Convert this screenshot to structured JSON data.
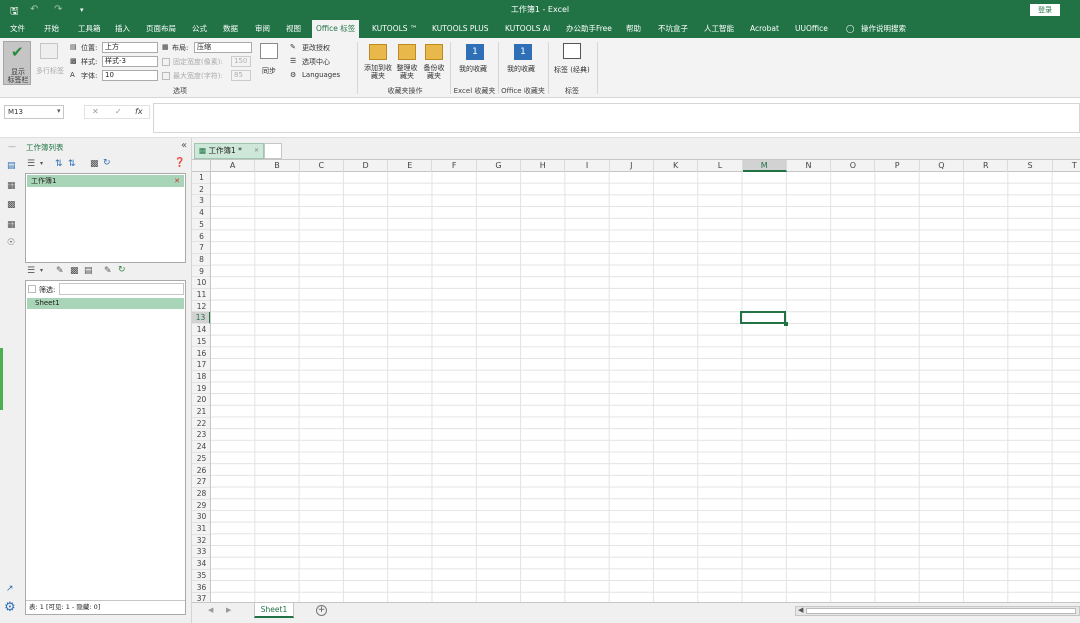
{
  "titlebar": {
    "title": "工作簿1  -  Excel",
    "login_label": "登录",
    "save_icon": "save-icon",
    "undo_icon": "undo-icon",
    "redo_icon": "redo-icon",
    "customize_icon": "customize-qa-icon"
  },
  "menu": {
    "tabs": [
      "文件",
      "开始",
      "工具箱",
      "插入",
      "页面布局",
      "公式",
      "数据",
      "审阅",
      "视图",
      "Office 标签",
      "KUTOOLS ™",
      "KUTOOLS PLUS",
      "KUTOOLS AI",
      "办公助手Free",
      "帮助",
      "不坑盒子",
      "人工智能",
      "Acrobat",
      "UUOffice"
    ],
    "active": "Office 标签",
    "search_label": "操作说明搜索"
  },
  "ribbon": {
    "show_tabbar": "显示\n标签栏",
    "multirow_tab": "多行标签",
    "position_label": "位置:",
    "position_value": "上方",
    "style_label": "样式:",
    "style_value": "样式-3",
    "font_label": "字体:",
    "font_value": "10",
    "layout_label": "布局:",
    "layout_value": "压缩",
    "fixed_width_label": "固定宽度(像素):",
    "fixed_width_value": "150",
    "max_width_label": "最大宽度(字符):",
    "max_width_value": "85",
    "sync_label": "同步",
    "change_auth": "更改授权",
    "options_center": "选项中心",
    "languages": "Languages",
    "group_options": "选项",
    "add_fav": "添加到收\n藏夹",
    "organize_fav": "整理收\n藏夹",
    "backup_fav": "备份收\n藏夹",
    "group_fav_ops": "收藏夹操作",
    "my_fav_excel": "我的收藏",
    "group_excel_fav": "Excel 收藏夹",
    "my_fav_office": "我的收藏",
    "group_office_fav": "Office 收藏夹",
    "tab_classic": "标签 (经典)",
    "group_tabs": "标签"
  },
  "formula_bar": {
    "name_box": "M13",
    "cancel": "✕",
    "enter": "✓",
    "fx": "fx"
  },
  "left_pane": {
    "title": "工作簿列表",
    "workbook_item": "工作簿1",
    "filter_label": "筛选:",
    "sheet_item": "Sheet1",
    "status": "表: 1  [可见: 1 - 隐藏: 0]"
  },
  "sheet_area": {
    "doc_tab": "工作簿1 *",
    "columns": [
      "A",
      "B",
      "C",
      "D",
      "E",
      "F",
      "G",
      "H",
      "I",
      "J",
      "K",
      "L",
      "M",
      "N",
      "O",
      "P",
      "Q",
      "R",
      "S",
      "T"
    ],
    "selected_column": "M",
    "rows": [
      "1",
      "2",
      "3",
      "4",
      "5",
      "6",
      "7",
      "8",
      "9",
      "10",
      "11",
      "12",
      "13",
      "14",
      "15",
      "16",
      "17",
      "18",
      "19",
      "20",
      "21",
      "22",
      "23",
      "24",
      "25",
      "26",
      "27",
      "28",
      "29",
      "30",
      "31",
      "32",
      "33",
      "34",
      "35",
      "36",
      "37"
    ],
    "selected_row": "13",
    "sheet_tab": "Sheet1",
    "add_sheet": "+"
  }
}
